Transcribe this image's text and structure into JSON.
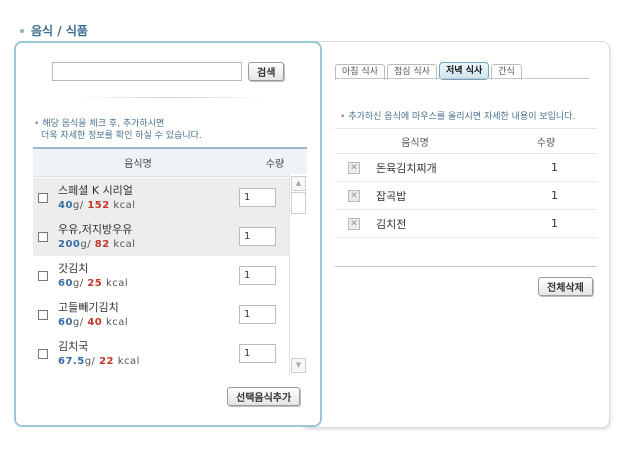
{
  "page": {
    "title": "음식 / 식품"
  },
  "search": {
    "value": "",
    "button_label": "검색"
  },
  "left": {
    "notice_line1": "해당 음식을 체크 후, 추가하시면",
    "notice_line2": "더욱 자세한 정보를 확인 하실 수 있습니다.",
    "col_name": "음식명",
    "col_qty": "수량",
    "items": [
      {
        "name": "스페셜 K 시리얼",
        "grams": "40",
        "g_unit": "g/",
        "kcal": "152",
        "kcal_unit": "kcal",
        "qty": "1",
        "checked": false
      },
      {
        "name": "우유,저지방우유",
        "grams": "200",
        "g_unit": "g/",
        "kcal": "82",
        "kcal_unit": "kcal",
        "qty": "1",
        "checked": false
      },
      {
        "name": "갓김치",
        "grams": "60",
        "g_unit": "g/",
        "kcal": "25",
        "kcal_unit": "kcal",
        "qty": "1",
        "checked": false
      },
      {
        "name": "고들빼기김치",
        "grams": "60",
        "g_unit": "g/",
        "kcal": "40",
        "kcal_unit": "kcal",
        "qty": "1",
        "checked": false
      },
      {
        "name": "김치국",
        "grams": "67.5",
        "g_unit": "g/",
        "kcal": "22",
        "kcal_unit": "kcal",
        "qty": "1",
        "checked": false
      }
    ],
    "add_button_label": "선택음식추가"
  },
  "right": {
    "tabs": [
      {
        "label": "아침 식사",
        "active": false
      },
      {
        "label": "점심 식사",
        "active": false
      },
      {
        "label": "저녁 식사",
        "active": true
      },
      {
        "label": "간식",
        "active": false
      }
    ],
    "notice": "추가하신 음식에 마우스를 올리시면 자세한 내용이 보입니다.",
    "col_name": "음식명",
    "col_qty": "수량",
    "items": [
      {
        "name": "돈육김치찌개",
        "qty": "1"
      },
      {
        "name": "잡곡밥",
        "qty": "1"
      },
      {
        "name": "김치전",
        "qty": "1"
      }
    ],
    "delete_all_label": "전체삭제"
  }
}
